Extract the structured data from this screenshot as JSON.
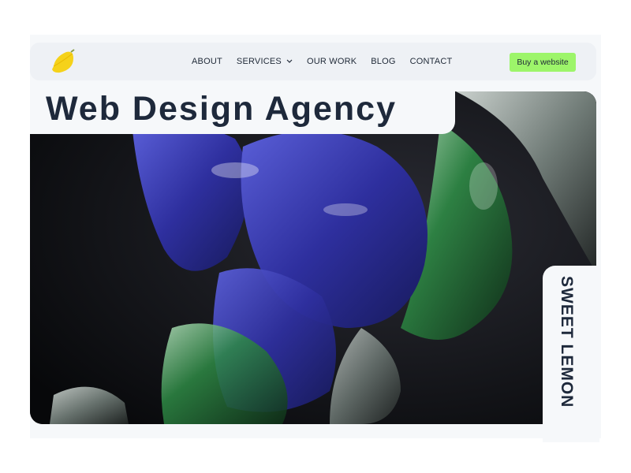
{
  "nav": {
    "links": [
      {
        "label": "ABOUT"
      },
      {
        "label": "SERVICES"
      },
      {
        "label": "OUR WORK"
      },
      {
        "label": "BLOG"
      },
      {
        "label": "CONTACT"
      }
    ],
    "cta_label": "Buy a website"
  },
  "hero": {
    "title": "Web Design Agency",
    "side_label": "SWEET LEMON"
  },
  "colors": {
    "cta_bg": "#9df56a",
    "text_dark": "#1e293b",
    "logo_lemon": "#f5d21a"
  }
}
